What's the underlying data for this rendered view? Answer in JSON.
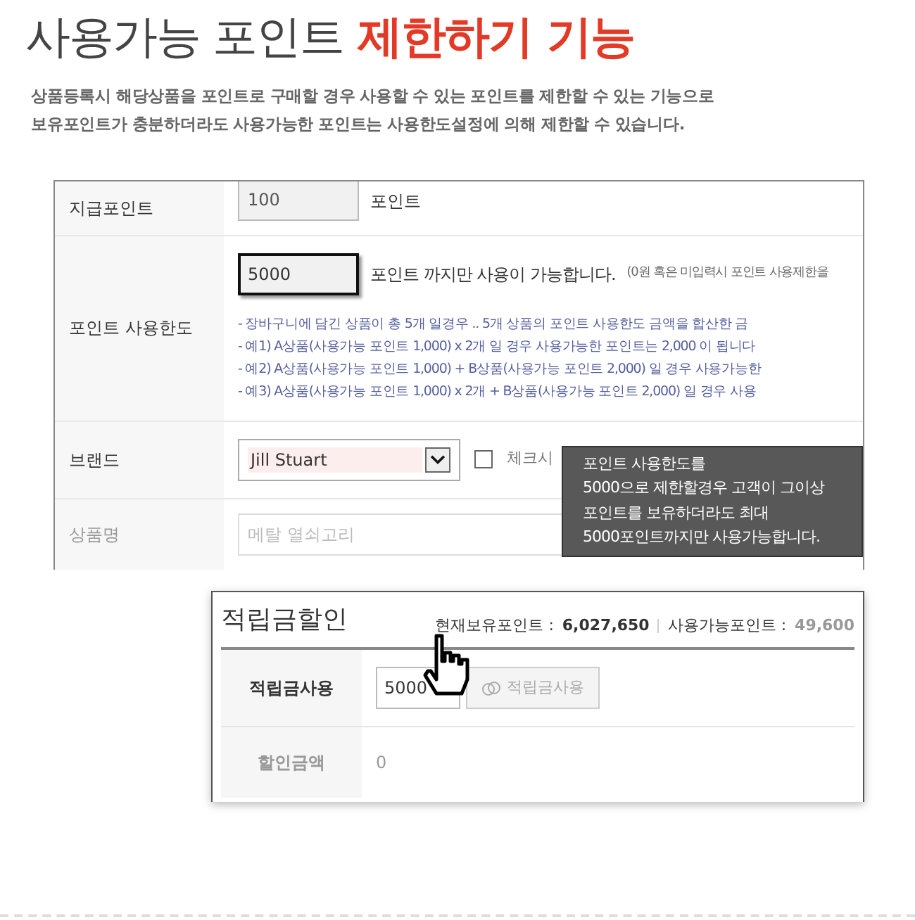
{
  "title": {
    "text": "사용가능 포인트",
    "highlight": "제한하기 기능"
  },
  "description": [
    "상품등록시 해당상품을 포인트로 구매할 경우 사용할 수 있는 포인트를 제한할 수 있는 기능으로",
    "보유포인트가 충분하더라도 사용가능한 포인트는 사용한도설정에 의해 제한할 수 있습니다."
  ],
  "settings_form": {
    "given_points": {
      "label": "지급포인트",
      "value": "100",
      "unit": "포인트"
    },
    "point_limit": {
      "label": "포인트 사용한도",
      "value": "5000",
      "suffix": "포인트 까지만 사용이 가능합니다.",
      "hint": "(0원 혹은 미입력시 포인트 사용제한을",
      "notes": [
        "- 장바구니에 담긴 상품이 총 5개 일경우 .. 5개 상품의 포인트 사용한도 금액을 합산한 금",
        "- 예1) A상품(사용가능 포인트 1,000) x 2개 일 경우 사용가능한 포인트는 2,000 이 됩니다",
        "- 예2) A상품(사용가능 포인트 1,000) + B상품(사용가능 포인트 2,000) 일 경우 사용가능한",
        "- 예3) A상품(사용가능 포인트 1,000) x 2개 + B상품(사용가능 포인트 2,000) 일 경우 사용"
      ]
    },
    "brand": {
      "label": "브랜드",
      "value": "Jill Stuart",
      "checkbox_label": "체크시",
      "checked": false
    },
    "product_name": {
      "label": "상품명",
      "placeholder": "메탈 열쇠고리"
    }
  },
  "tooltip": [
    "포인트 사용한도를",
    "5000으로 제한할경우 고객이 그이상",
    "포인트를 보유하더라도 최대",
    "5000포인트까지만 사용가능합니다."
  ],
  "discount_panel": {
    "title": "적립금할인",
    "held_label": "현재보유포인트 :",
    "held_value": "6,027,650",
    "available_label": "사용가능포인트 :",
    "available_value": "49,600",
    "use_label": "적립금사용",
    "use_value": "5000",
    "use_button": "적립금사용",
    "amount_label": "할인금액",
    "amount_value": "0"
  }
}
